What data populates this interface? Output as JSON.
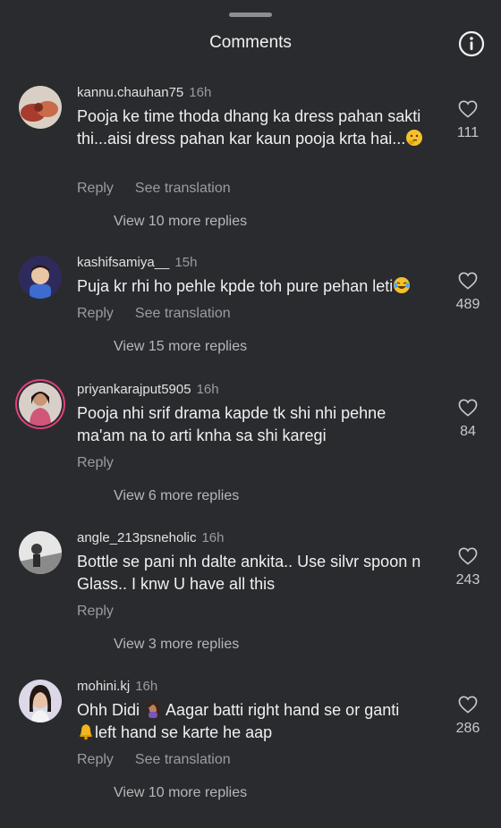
{
  "header": {
    "title": "Comments",
    "info_icon": "info-icon"
  },
  "labels": {
    "reply": "Reply",
    "see_translation": "See translation"
  },
  "colors": {
    "background": "#2a2b2e",
    "story_ring": "#e0407a"
  },
  "comments": [
    {
      "username": "kannu.chauhan75",
      "time": "16h",
      "text": "Pooja ke time thoda dhang ka dress pahan sakti thi...aisi dress pahan kar kaun pooja krta hai...",
      "emoji": "thinking-face-icon",
      "likes": "111",
      "view_replies": "View 10 more replies",
      "has_translation": true
    },
    {
      "username": "kashifsamiya__",
      "time": "15h",
      "text": "Puja kr rhi ho pehle kpde toh pure pehan leti",
      "emoji": "laughing-tears-icon",
      "likes": "489",
      "view_replies": "View 15 more replies",
      "has_translation": true
    },
    {
      "username": "priyankarajput5905",
      "time": "16h",
      "text": "Pooja nhi srif drama kapde tk shi nhi pehne ma'am na to arti knha sa shi karegi",
      "likes": "84",
      "view_replies": "View 6 more replies",
      "has_translation": false
    },
    {
      "username": "angle_213psneholic",
      "time": "16h",
      "text": "Bottle se pani nh dalte ankita.. Use silvr spoon n Glass.. I knw U have all this",
      "likes": "243",
      "view_replies": "View 3 more replies",
      "has_translation": false
    },
    {
      "username": "mohini.kj",
      "time": "16h",
      "text_a": "Ohh Didi",
      "text_b": " Aagar batti right hand se or ganti",
      "text_c": "left hand se karte he aap",
      "emoji_a": "facepalm-woman-icon",
      "emoji_b": "bell-icon",
      "likes": "286",
      "view_replies": "View 10 more replies",
      "has_translation": true
    }
  ]
}
